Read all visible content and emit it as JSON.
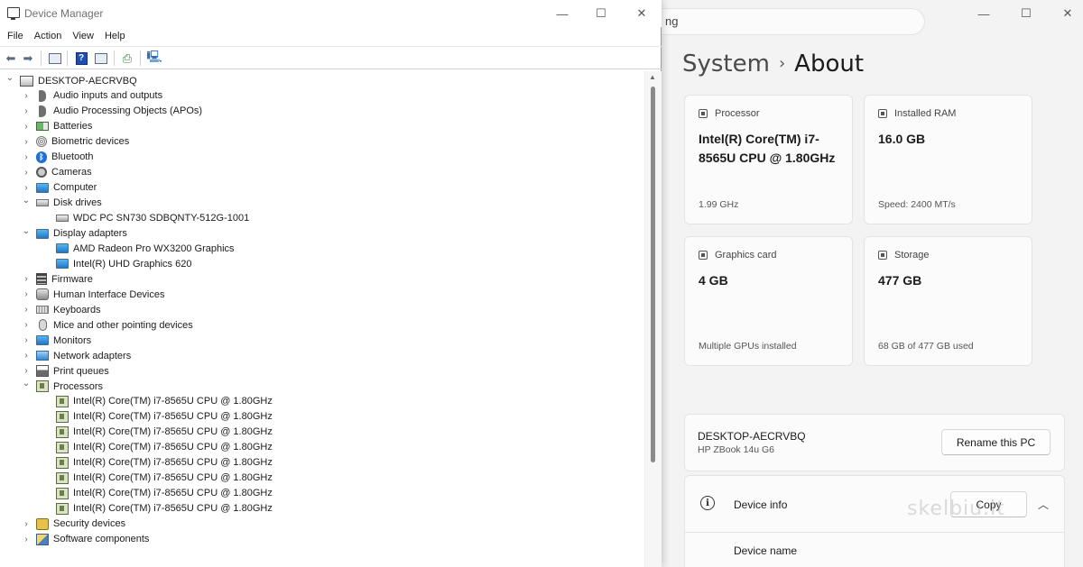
{
  "settings": {
    "search_text": "ng",
    "breadcrumb": {
      "parent": "System",
      "separator": "›",
      "current": "About"
    },
    "cards": [
      {
        "label": "Processor",
        "value": "Intel(R) Core(TM) i7-8565U CPU @ 1.80GHz",
        "sub": "1.99 GHz"
      },
      {
        "label": "Installed RAM",
        "value": "16.0 GB",
        "sub": "Speed: 2400 MT/s"
      },
      {
        "label": "Graphics card",
        "value": "4 GB",
        "sub": "Multiple GPUs installed"
      },
      {
        "label": "Storage",
        "value": "477 GB",
        "sub": "68 GB of 477 GB used"
      }
    ],
    "pc_name": "DESKTOP-AECRVBQ",
    "pc_model": "HP ZBook 14u G6",
    "rename_label": "Rename this PC",
    "device_info_label": "Device info",
    "copy_label": "Copy",
    "device_name_label": "Device name",
    "watermark": "skelbiu.lt"
  },
  "dm": {
    "title": "Device Manager",
    "menu": [
      "File",
      "Action",
      "View",
      "Help"
    ],
    "tree": [
      {
        "label": "DESKTOP-AECRVBQ",
        "level": 0,
        "expand": "open",
        "icon": "pc"
      },
      {
        "label": "Audio inputs and outputs",
        "level": 1,
        "expand": "closed",
        "icon": "spk"
      },
      {
        "label": "Audio Processing Objects (APOs)",
        "level": 1,
        "expand": "closed",
        "icon": "spk"
      },
      {
        "label": "Batteries",
        "level": 1,
        "expand": "closed",
        "icon": "bat"
      },
      {
        "label": "Biometric devices",
        "level": 1,
        "expand": "closed",
        "icon": "bio"
      },
      {
        "label": "Bluetooth",
        "level": 1,
        "expand": "closed",
        "icon": "bt"
      },
      {
        "label": "Cameras",
        "level": 1,
        "expand": "closed",
        "icon": "cam"
      },
      {
        "label": "Computer",
        "level": 1,
        "expand": "closed",
        "icon": "mon"
      },
      {
        "label": "Disk drives",
        "level": 1,
        "expand": "open",
        "icon": "disk"
      },
      {
        "label": "WDC PC SN730 SDBQNTY-512G-1001",
        "level": 2,
        "expand": "none",
        "icon": "disk"
      },
      {
        "label": "Display adapters",
        "level": 1,
        "expand": "open",
        "icon": "mon"
      },
      {
        "label": "AMD Radeon Pro WX3200 Graphics",
        "level": 2,
        "expand": "none",
        "icon": "mon"
      },
      {
        "label": "Intel(R) UHD Graphics 620",
        "level": 2,
        "expand": "none",
        "icon": "mon"
      },
      {
        "label": "Firmware",
        "level": 1,
        "expand": "closed",
        "icon": "fw"
      },
      {
        "label": "Human Interface Devices",
        "level": 1,
        "expand": "closed",
        "icon": "hid"
      },
      {
        "label": "Keyboards",
        "level": 1,
        "expand": "closed",
        "icon": "kbd"
      },
      {
        "label": "Mice and other pointing devices",
        "level": 1,
        "expand": "closed",
        "icon": "mouse"
      },
      {
        "label": "Monitors",
        "level": 1,
        "expand": "closed",
        "icon": "mon"
      },
      {
        "label": "Network adapters",
        "level": 1,
        "expand": "closed",
        "icon": "net"
      },
      {
        "label": "Print queues",
        "level": 1,
        "expand": "closed",
        "icon": "prn"
      },
      {
        "label": "Processors",
        "level": 1,
        "expand": "open",
        "icon": "cpu"
      },
      {
        "label": "Intel(R) Core(TM) i7-8565U CPU @ 1.80GHz",
        "level": 2,
        "expand": "none",
        "icon": "cpu"
      },
      {
        "label": "Intel(R) Core(TM) i7-8565U CPU @ 1.80GHz",
        "level": 2,
        "expand": "none",
        "icon": "cpu"
      },
      {
        "label": "Intel(R) Core(TM) i7-8565U CPU @ 1.80GHz",
        "level": 2,
        "expand": "none",
        "icon": "cpu"
      },
      {
        "label": "Intel(R) Core(TM) i7-8565U CPU @ 1.80GHz",
        "level": 2,
        "expand": "none",
        "icon": "cpu"
      },
      {
        "label": "Intel(R) Core(TM) i7-8565U CPU @ 1.80GHz",
        "level": 2,
        "expand": "none",
        "icon": "cpu"
      },
      {
        "label": "Intel(R) Core(TM) i7-8565U CPU @ 1.80GHz",
        "level": 2,
        "expand": "none",
        "icon": "cpu"
      },
      {
        "label": "Intel(R) Core(TM) i7-8565U CPU @ 1.80GHz",
        "level": 2,
        "expand": "none",
        "icon": "cpu"
      },
      {
        "label": "Intel(R) Core(TM) i7-8565U CPU @ 1.80GHz",
        "level": 2,
        "expand": "none",
        "icon": "cpu"
      },
      {
        "label": "Security devices",
        "level": 1,
        "expand": "closed",
        "icon": "sec"
      },
      {
        "label": "Software components",
        "level": 1,
        "expand": "closed",
        "icon": "sw"
      }
    ]
  }
}
